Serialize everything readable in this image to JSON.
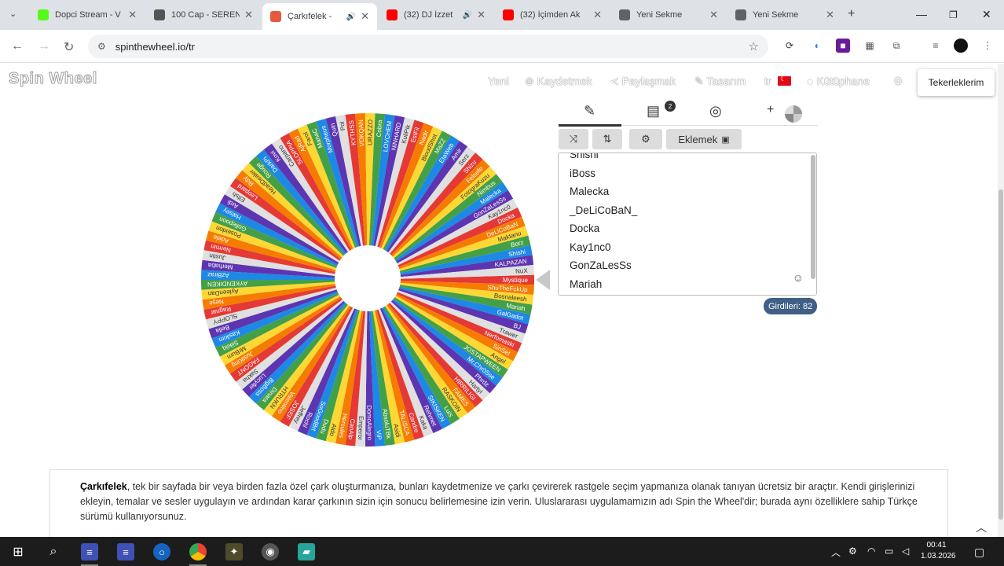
{
  "tabs": [
    {
      "title": "Dopci Stream - V",
      "icon": "kick-icon",
      "color": "#53fc18"
    },
    {
      "title": "100 Cap - SEREN",
      "icon": "v-logo-icon",
      "color": "#555555"
    },
    {
      "title": "Çarkıfelek -",
      "icon": "spinthewheel-icon",
      "color": "#e6593a",
      "active": true
    },
    {
      "title": "(32) DJ İzzet",
      "icon": "youtube-icon",
      "color": "#ff0000"
    },
    {
      "title": "(32) İçimden Ak",
      "icon": "youtube-icon",
      "color": "#ff0000"
    },
    {
      "title": "Yeni Sekme",
      "icon": "globe-icon",
      "color": "#5f6368"
    },
    {
      "title": "Yeni Sekme",
      "icon": "globe-icon",
      "color": "#5f6368"
    }
  ],
  "address": {
    "url": "spinthewheel.io/tr"
  },
  "site": {
    "logo": "Spin Wheel",
    "menu": {
      "new": "Yeni",
      "save": "Kaydetmek",
      "share": "Paylaşmak",
      "design": "Tasarım",
      "lang": "tr",
      "library": "Kütüphane",
      "my_wheels": "Tekerleklerim"
    },
    "add_button": "Eklemek",
    "entries": [
      "Shishi",
      "iBoss",
      "Malecka",
      "_DeLiCoBaN_",
      "Docka",
      "Kay1nc0",
      "GonZaLesSs",
      "Mariah"
    ],
    "entry_count": "Girdileri: 82",
    "results_badge": "2",
    "description": {
      "bold": "Çarkıfelek",
      "text": ", tek bir sayfada bir veya birden fazla özel çark oluşturmanıza, bunları kaydetmenize ve çarkı çevirerek rastgele seçim yapmanıza olanak tanıyan ücretsiz bir araçtır. Kendi girişlerinizi ekleyin, temalar ve sesler uygulayın ve ardından karar çarkının sizin için sonucu belirlemesine izin verin. Uluslararası uygulamamızın adı Spin the Wheel'dir; burada aynı özelliklere sahip Türkçe sürümü kullanıyorsunuz."
    }
  },
  "wheel": {
    "colors": [
      "#e53935",
      "#f57c00",
      "#fdd835",
      "#43a047",
      "#1e88e5",
      "#5e35b1",
      "#e0e0e0"
    ],
    "labels": [
      "Mystique",
      "ShuTheFckUp",
      "Bosnaleesh",
      "Mariah",
      "GalGadot",
      "BJ",
      "Trawer",
      "Nerfomaski",
      "SinSet",
      "Angel",
      "JOSTAPWEEN",
      "Mr.Chr0Sse",
      "Phrdz",
      "Hartyi",
      "HIRRILIGI",
      "FAMES",
      "RASKOIN",
      "Luis",
      "SIKISKEN",
      "Rehmet",
      "Kaka",
      "Candre",
      "TALISCA",
      "Asidi",
      "AbsoluTBk",
      "ViP",
      "DomoAlegro",
      "Emperor",
      "CanAlp",
      "Hercules",
      "Aldo",
      "Dudu",
      "SoGoodBrt",
      "Rochl",
      "Jeffrey",
      "JOSEF",
      "Valentino",
      "HTRUKN",
      "Dinara",
      "BigBoss",
      "Lucyfer",
      "Sakha",
      "FAGONT",
      "JustKing",
      "MrBurn",
      "Siikiiq",
      "Kasikim",
      "Bella",
      "SLOPPY",
      "Ragnar",
      "Neşe",
      "AyleenDan",
      "AYKENDIKEN",
      "AzBiraz",
      "Merhaba",
      "Justin",
      "Nermin",
      "Adele",
      "Poseidon",
      "Gollepoon",
      "Halsey",
      "Ardi",
      "Elfsh",
      "Leopard",
      "Rdy",
      "HeadDealer",
      "Rouge",
      "DarkPi",
      "Kovi",
      "Carpano",
      "SLOPPIA",
      "AjRad",
      "Farol",
      "ManaC",
      "Morpheus",
      "Quin",
      "Pol",
      "KYTHSS",
      "VOKQAN",
      "URAZZO",
      "Cobra",
      "LOVCHEM",
      "NiNHARD",
      "KuliPik",
      "EsIFil",
      "Nadir",
      "BloodShot",
      "MaZZ",
      "EtaWeb",
      "Amir",
      "Serz",
      "Shizu",
      "Felsefe",
      "FotograKuzu",
      "Nimbus",
      "Malecka",
      "GonZaLesSs",
      "Kay1nc0",
      "Docka",
      "DeLiCoBaN",
      "Maktanu",
      "Borz",
      "Shishi",
      "KALPAZAN",
      "NuX"
    ]
  },
  "taskbar": {
    "time": "00:41",
    "date": "1.03.2026"
  }
}
